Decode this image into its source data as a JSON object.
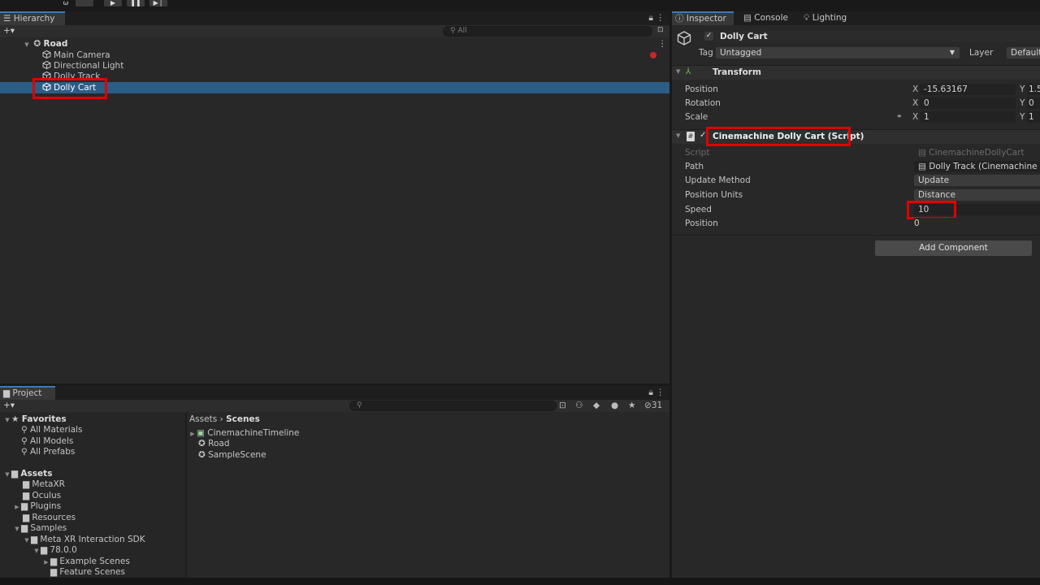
{
  "toolbar": {
    "play_icon": "▶",
    "pause_icon": "❚❚",
    "step_icon": "▶❘"
  },
  "hierarchy": {
    "tab_label": "Hierarchy",
    "add_label": "+▾",
    "search_placeholder": "All",
    "scene_name": "Road",
    "items": [
      {
        "label": "Main Camera"
      },
      {
        "label": "Directional Light"
      },
      {
        "label": "Dolly Track"
      },
      {
        "label": "Dolly Cart"
      }
    ]
  },
  "inspector": {
    "tabs": [
      {
        "label": "Inspector"
      },
      {
        "label": "Console"
      },
      {
        "label": "Lighting"
      }
    ],
    "object_name": "Dolly Cart",
    "tag_label": "Tag",
    "tag_value": "Untagged",
    "layer_label": "Layer",
    "layer_value": "Default",
    "transform": {
      "title": "Transform",
      "position_label": "Position",
      "rotation_label": "Rotation",
      "scale_label": "Scale",
      "position_x": "-15.63167",
      "position_y_partial": "1.5",
      "rotation_x": "0",
      "rotation_y_partial": "0",
      "scale_x": "1",
      "scale_y_partial": "1",
      "axis_x": "X",
      "axis_y": "Y"
    },
    "dolly_cart": {
      "title": "Cinemachine Dolly Cart (Script)",
      "script_label": "Script",
      "script_value": "CinemachineDollyCart",
      "path_label": "Path",
      "path_value": "Dolly Track (Cinemachine Smo",
      "update_method_label": "Update Method",
      "update_method_value": "Update",
      "position_units_label": "Position Units",
      "position_units_value": "Distance",
      "speed_label": "Speed",
      "speed_value": "10",
      "position_label": "Position",
      "position_value": "0"
    },
    "add_component_label": "Add Component"
  },
  "project": {
    "tab_label": "Project",
    "add_label": "+▾",
    "hidden_count": "31",
    "favorites_label": "Favorites",
    "favorites": [
      {
        "label": "All Materials"
      },
      {
        "label": "All Models"
      },
      {
        "label": "All Prefabs"
      }
    ],
    "assets_label": "Assets",
    "tree": [
      {
        "label": "MetaXR"
      },
      {
        "label": "Oculus"
      },
      {
        "label": "Plugins"
      },
      {
        "label": "Resources"
      },
      {
        "label": "Samples"
      },
      {
        "label": "Meta XR Interaction SDK"
      },
      {
        "label": "78.0.0"
      },
      {
        "label": "Example Scenes"
      },
      {
        "label": "Feature Scenes"
      }
    ],
    "breadcrumb_root": "Assets",
    "breadcrumb_sep": "›",
    "breadcrumb_current": "Scenes",
    "files": [
      {
        "label": "CinemachineTimeline"
      },
      {
        "label": "Road"
      },
      {
        "label": "SampleScene"
      }
    ]
  },
  "colors": {
    "selection": "#2c5d87",
    "highlight": "#e00000",
    "accent": "#3a79bb"
  }
}
